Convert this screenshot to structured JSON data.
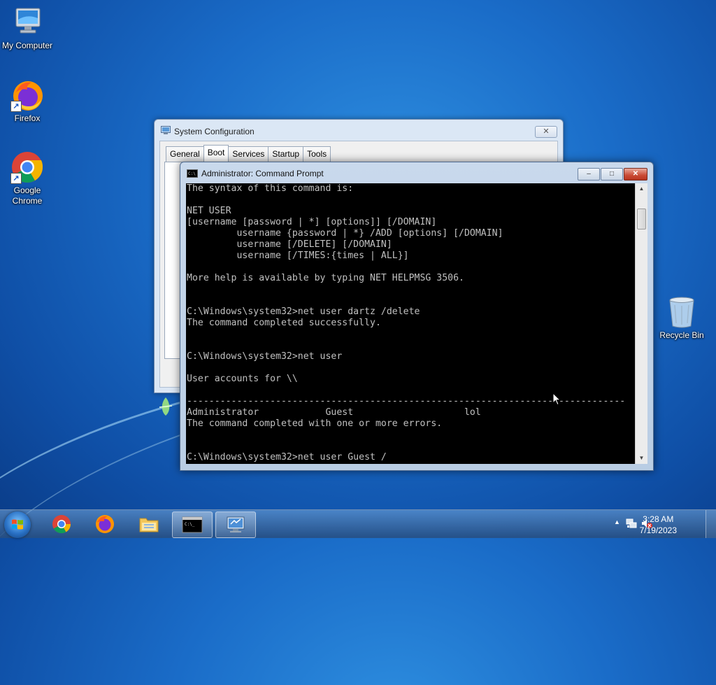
{
  "desktop": {
    "icons": [
      {
        "label": "My Computer"
      },
      {
        "label": "Firefox"
      },
      {
        "label": "Google Chrome"
      },
      {
        "label": "Recycle Bin"
      }
    ]
  },
  "sysconfig": {
    "title": "System Configuration",
    "close_label": "✕",
    "tabs": [
      "General",
      "Boot",
      "Services",
      "Startup",
      "Tools"
    ],
    "active_tab": "Boot"
  },
  "cmd": {
    "title": "Administrator:  Command Prompt",
    "minimize_label": "‒",
    "maximize_label": "□",
    "close_label": "✕",
    "output": "The syntax of this command is:\n\nNET USER\n[username [password | *] [options]] [/DOMAIN]\n         username {password | *} /ADD [options] [/DOMAIN]\n         username [/DELETE] [/DOMAIN]\n         username [/TIMES:{times | ALL}]\n\nMore help is available by typing NET HELPMSG 3506.\n\n\nC:\\Windows\\system32>net user dartz /delete\nThe command completed successfully.\n\n\nC:\\Windows\\system32>net user\n\nUser accounts for \\\\\n\n-------------------------------------------------------------------------------\nAdministrator            Guest                    lol\nThe command completed with one or more errors.\n\n\nC:\\Windows\\system32>net user Guest /"
  },
  "taskbar": {
    "apps": [
      "Chrome",
      "Firefox",
      "Windows Explorer",
      "Command Prompt",
      "System Configuration"
    ],
    "active": [
      "Command Prompt",
      "System Configuration"
    ],
    "clock_time": "3:28 AM",
    "clock_date": "7/19/2023"
  },
  "colors": {
    "desktop_bg": "#1a6cc8",
    "console_bg": "#000000",
    "console_text": "#c0c0c0",
    "close_red": "#c94a35"
  }
}
